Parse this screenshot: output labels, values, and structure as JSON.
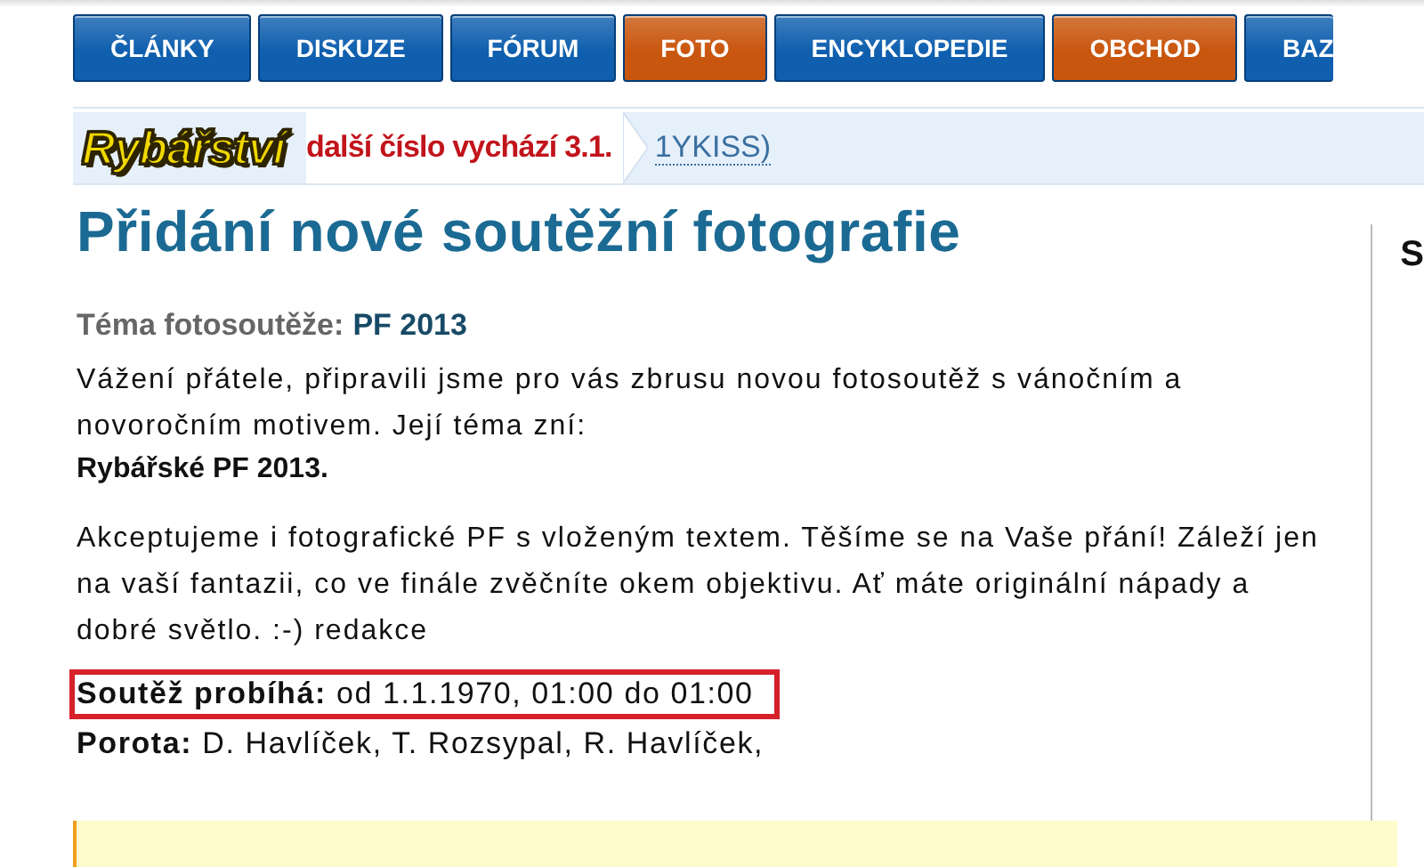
{
  "tabs": [
    {
      "label": "ČLÁNKY",
      "color": "#0f5fae"
    },
    {
      "label": "DISKUZE",
      "color": "#0f5fae"
    },
    {
      "label": "FÓRUM",
      "color": "#0f5fae"
    },
    {
      "label": "FOTO",
      "color": "#c9560e"
    },
    {
      "label": "ENCYKLOPEDIE",
      "color": "#0f5fae"
    },
    {
      "label": "OBCHOD",
      "color": "#c9560e"
    },
    {
      "label": "BAZ",
      "color": "#0f5fae"
    }
  ],
  "banner": {
    "logo": "Rybářství",
    "notice": "další číslo vychází 3.1.",
    "link": "1YKISS)"
  },
  "heading": "Přidání nové soutěžní fotografie",
  "theme": {
    "label": "Téma fotosoutěže:",
    "value": "PF 2013"
  },
  "paragraphs": [
    "Vážení přátele, připravili jsme pro vás zbrusu novou fotosoutěž s vánočním a novoročním motivem. Její téma zní:"
  ],
  "theme_name": "Rybářské PF 2013.",
  "paragraphs_2": [
    "Akceptujeme i fotografické PF s vloženým textem. Těšíme se na Vaše přání! Záleží jen na vaší fantazii, co ve finále zvěčníte okem objektivu. Ať máte originální nápady a dobré světlo. :-) redakce"
  ],
  "details": [
    {
      "text": "**Soutěž probíhá:** od 1.1.1970, 01:00 do 01:00",
      "highlighted": true
    },
    {
      "text": "**Porota:** D. Havlíček, T. Rozsypal, R. Havlíček,",
      "highlighted": false
    }
  ],
  "sidebar": {
    "heading": "S"
  }
}
